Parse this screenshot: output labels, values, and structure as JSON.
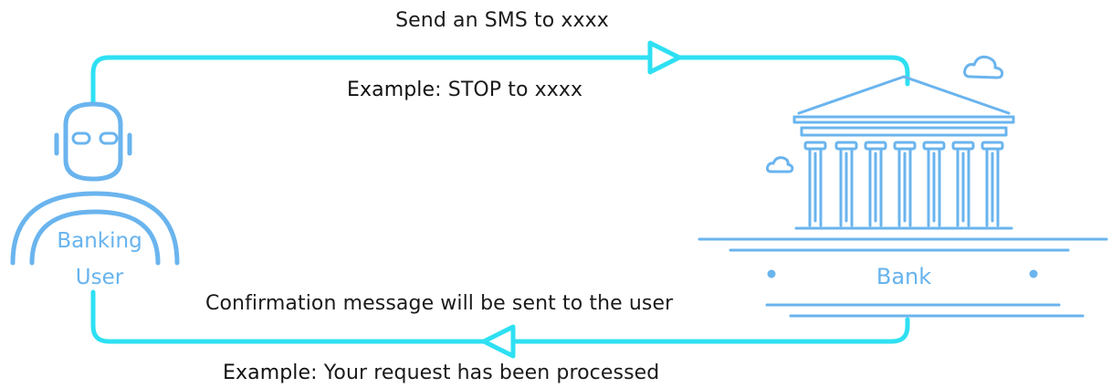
{
  "diagram": {
    "top_message": "Send an SMS to xxxx",
    "top_example_key": "Example",
    "top_example_value": ":  STOP to xxxx",
    "bottom_message": "Confirmation message will be sent to the user",
    "bottom_example_key": "Example",
    "bottom_example_value": ":  Your request has been processed",
    "user_label_line1": "Banking",
    "user_label_line2": "User",
    "bank_label": "Bank",
    "colors": {
      "flow_line": "#2ee0f2",
      "icon_stroke": "#6ab4ee",
      "text": "#1a1a1a"
    }
  }
}
